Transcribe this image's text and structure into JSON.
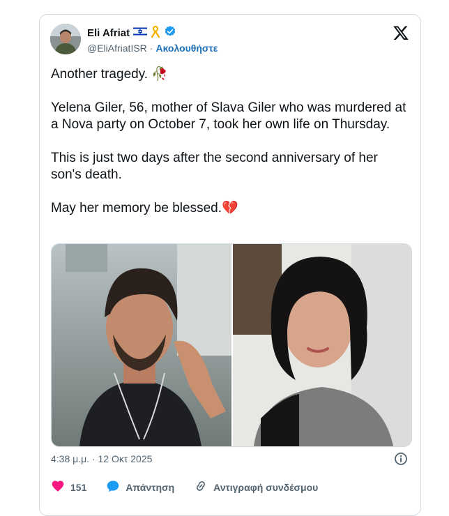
{
  "author": {
    "name": "Eli Afriat",
    "handle": "@EliAfriatISR",
    "separator": "·",
    "follow_label": "Ακολουθήστε",
    "flag_icon": "israel-flag-icon",
    "ribbon_icon": "yellow-ribbon-icon",
    "verified_icon": "verified-badge-icon"
  },
  "tweet": {
    "paragraphs": [
      "Another tragedy. 🥀",
      "Yelena Giler, 56, mother of Slava Giler who was murdered at a Nova party on October 7, took her own life on Thursday.",
      "This is just two days after the second anniversary of her son's death.",
      "May her memory be blessed.💔"
    ]
  },
  "media": {
    "images": [
      "young-man-photo",
      "woman-photo"
    ]
  },
  "timestamp": "4:38 μ.μ. · 12 Οκτ 2025",
  "actions": {
    "likes": "151",
    "reply_label": "Απάντηση",
    "copy_link_label": "Αντιγραφή συνδέσμου"
  },
  "colors": {
    "link": "#1d6fb8",
    "verified": "#1d9bf0",
    "like": "#f91880",
    "reply": "#1d9bf0"
  }
}
